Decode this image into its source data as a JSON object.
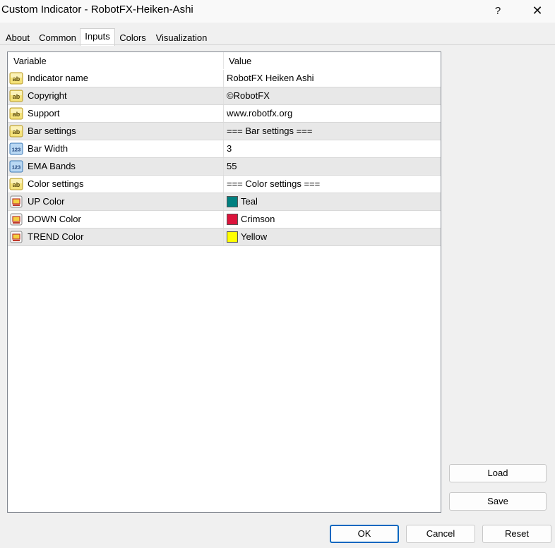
{
  "window": {
    "title": "Custom Indicator - RobotFX-Heiken-Ashi",
    "help_label": "?",
    "close_label": "✕"
  },
  "tabs": [
    {
      "label": "About"
    },
    {
      "label": "Common"
    },
    {
      "label": "Inputs"
    },
    {
      "label": "Colors"
    },
    {
      "label": "Visualization"
    }
  ],
  "active_tab": "Inputs",
  "table": {
    "headers": {
      "variable": "Variable",
      "value": "Value"
    },
    "rows": [
      {
        "icon": "string-ab-icon",
        "variable": "Indicator name",
        "value": "RobotFX Heiken Ashi"
      },
      {
        "icon": "string-ab-icon",
        "variable": "Copyright",
        "value": "©RobotFX"
      },
      {
        "icon": "string-ab-icon",
        "variable": "Support",
        "value": "www.robotfx.org"
      },
      {
        "icon": "string-ab-icon",
        "variable": "Bar settings",
        "value": "=== Bar settings ==="
      },
      {
        "icon": "number-123-icon",
        "variable": "Bar Width",
        "value": "3"
      },
      {
        "icon": "number-123-icon",
        "variable": "EMA Bands",
        "value": "55"
      },
      {
        "icon": "string-ab-icon",
        "variable": "Color settings",
        "value": "=== Color settings ==="
      },
      {
        "icon": "color-palette-icon",
        "variable": "UP Color",
        "value": "Teal",
        "color": "#008080"
      },
      {
        "icon": "color-palette-icon",
        "variable": "DOWN Color",
        "value": "Crimson",
        "color": "#dc143c"
      },
      {
        "icon": "color-palette-icon",
        "variable": "TREND Color",
        "value": "Yellow",
        "color": "#ffff00"
      }
    ]
  },
  "side_buttons": {
    "load": "Load",
    "save": "Save"
  },
  "footer_buttons": {
    "ok": "OK",
    "cancel": "Cancel",
    "reset": "Reset"
  },
  "colors": {
    "accent": "#0067c0",
    "row_alt": "#e8e8e8"
  }
}
